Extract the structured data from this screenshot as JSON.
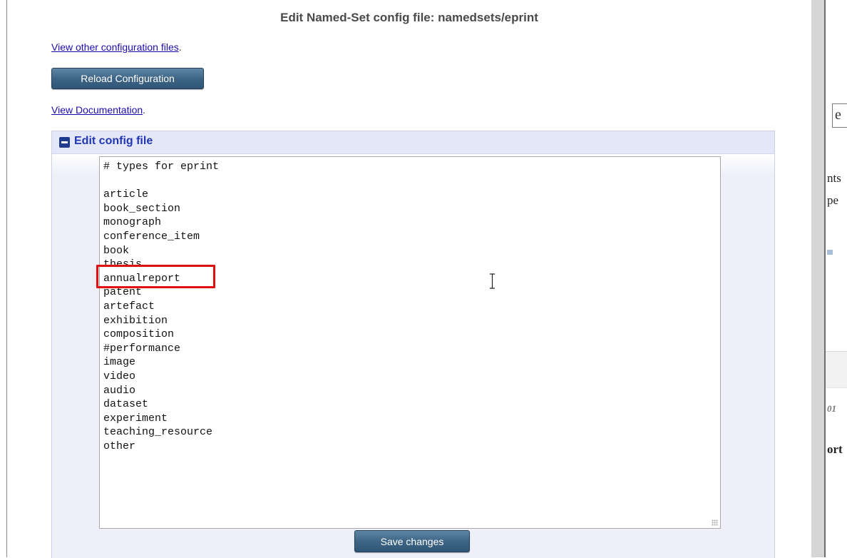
{
  "page": {
    "title": "Edit Named-Set config file: namedsets/eprint"
  },
  "links": {
    "view_other_configs": "View other configuration files",
    "view_docs": "View Documentation",
    "trailing_dot": "."
  },
  "buttons": {
    "reload": "Reload Configuration",
    "save": "Save changes"
  },
  "config_box": {
    "title": "Edit config file",
    "toggle_icon": "collapse-minus-icon"
  },
  "editor": {
    "lines": [
      "# types for eprint",
      "",
      "article",
      "book_section",
      "monograph",
      "conference_item",
      "book",
      "thesis",
      "annualreport",
      "patent",
      "artefact",
      "exhibition",
      "composition",
      "#performance",
      "image",
      "video",
      "audio",
      "dataset",
      "experiment",
      "teaching_resource",
      "other"
    ],
    "highlighted_line": "annualreport"
  },
  "right_pane": {
    "frag_box": "e",
    "frag_1": "nts",
    "frag_2": "pe",
    "frag_3": "01",
    "frag_4": "ort"
  },
  "colors": {
    "link": "#1a0dab",
    "button": "#3e6585",
    "highlight": "#e01010",
    "box_title": "#2136b5"
  }
}
